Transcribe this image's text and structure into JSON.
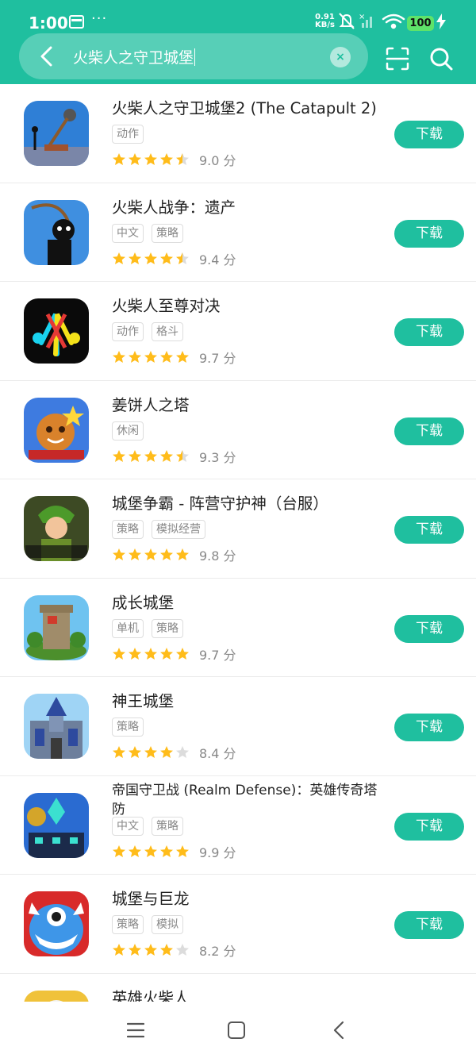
{
  "status_bar": {
    "time": "1:00",
    "net_speed_value": "0.91",
    "net_speed_unit": "KB/s",
    "battery": "100"
  },
  "search": {
    "query": "火柴人之守卫城堡",
    "clear_glyph": "×"
  },
  "icons": {
    "back": "back-arrow-icon",
    "scan": "scan-icon",
    "search": "search-icon",
    "clear": "close-icon"
  },
  "colors": {
    "accent": "#1fbf9f",
    "star": "#ffbc1a",
    "star_empty": "#dcdcdc"
  },
  "download_label": "下载",
  "apps": [
    {
      "title": "火柴人之守卫城堡2 (The Catapult 2)",
      "tags": [
        "动作"
      ],
      "rating": 4.5,
      "score": "9.0 分"
    },
    {
      "title": "火柴人战争：遗产",
      "tags": [
        "中文",
        "策略"
      ],
      "rating": 4.5,
      "score": "9.4 分"
    },
    {
      "title": "火柴人至尊对决",
      "tags": [
        "动作",
        "格斗"
      ],
      "rating": 5,
      "score": "9.7 分"
    },
    {
      "title": "姜饼人之塔",
      "tags": [
        "休闲"
      ],
      "rating": 4.5,
      "score": "9.3 分"
    },
    {
      "title": "城堡争霸 - 阵营守护神（台服）",
      "tags": [
        "策略",
        "模拟经营"
      ],
      "rating": 5,
      "score": "9.8 分"
    },
    {
      "title": "成长城堡",
      "tags": [
        "单机",
        "策略"
      ],
      "rating": 5,
      "score": "9.7 分"
    },
    {
      "title": "神王城堡",
      "tags": [
        "策略"
      ],
      "rating": 4,
      "score": "8.4 分"
    },
    {
      "title": "帝国守卫战 (Realm Defense)：英雄传奇塔防",
      "tags": [
        "中文",
        "策略"
      ],
      "rating": 5,
      "score": "9.9 分"
    },
    {
      "title": "城堡与巨龙",
      "tags": [
        "策略",
        "模拟"
      ],
      "rating": 4,
      "score": "8.2 分"
    },
    {
      "title": "英雄火柴人",
      "tags": [],
      "rating": 0,
      "score": ""
    }
  ]
}
